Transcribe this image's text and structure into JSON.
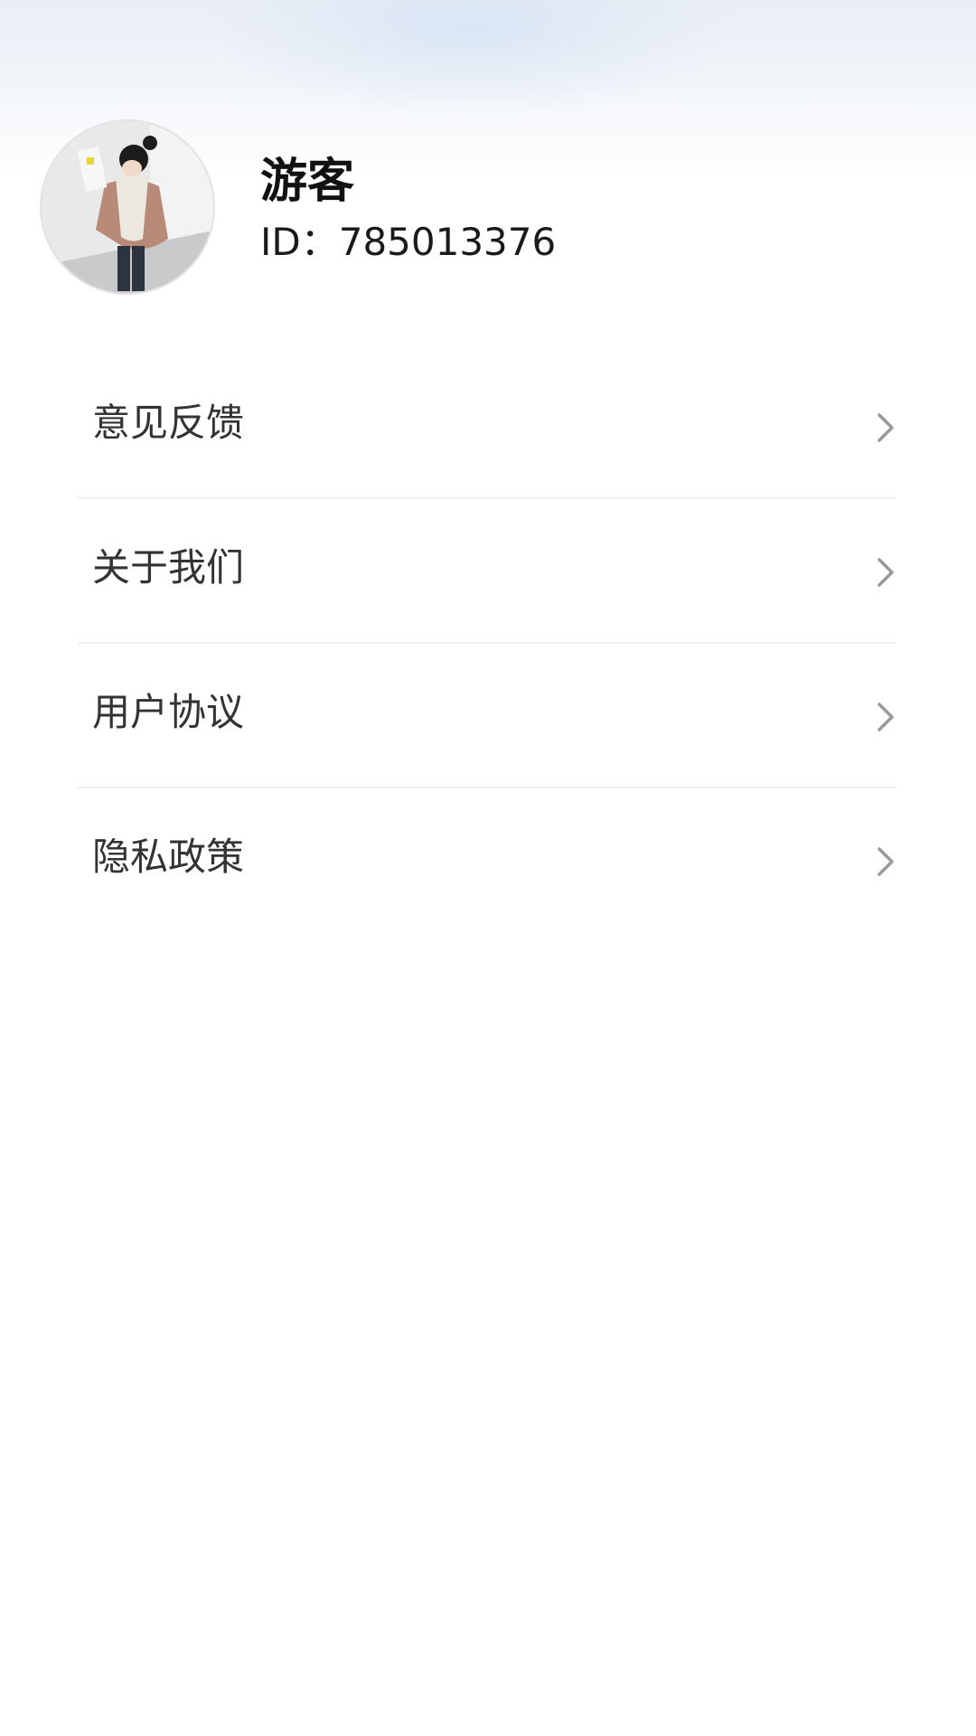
{
  "profile": {
    "username": "游客",
    "user_id": "ID：785013376",
    "avatar_icon": "user-avatar-photo"
  },
  "menu": {
    "items": [
      {
        "label": "意见反馈",
        "icon": "chevron-right-icon"
      },
      {
        "label": "关于我们",
        "icon": "chevron-right-icon"
      },
      {
        "label": "用户协议",
        "icon": "chevron-right-icon"
      },
      {
        "label": "隐私政策",
        "icon": "chevron-right-icon"
      }
    ]
  },
  "colors": {
    "header_gradient_top": "#e9eef5",
    "background": "#ffffff",
    "divider": "#f1f1f1",
    "chevron": "#999999",
    "label_text": "#333333"
  }
}
